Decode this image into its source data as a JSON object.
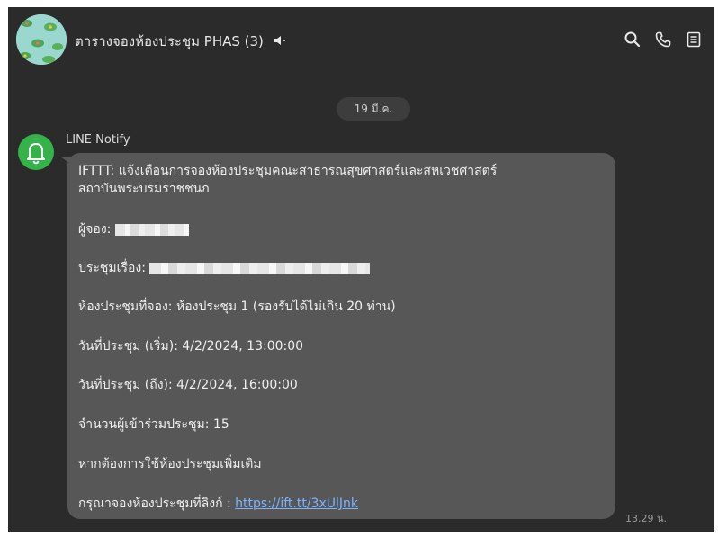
{
  "header": {
    "title": "ตารางจองห้องประชุม PHAS (3)",
    "icons": [
      "speaker-muted-icon",
      "search-icon",
      "phone-icon",
      "notes-icon"
    ]
  },
  "date_separator": "19 มี.ค.",
  "message": {
    "sender": "LINE Notify",
    "lines": [
      "IFTTT: แจ้งเตือนการจองห้องประชุมคณะสาธารณสุขศาสตร์และสหเวชศาสตร์",
      "สถาบันพระบรมราชชนก",
      "ผู้จอง:",
      "ประชุมเรื่อง:",
      "ห้องประชุมที่จอง: ห้องประชุม 1 (รองรับได้ไม่เกิน 20 ท่าน)",
      "วันที่ประชุม (เริ่ม): 4/2/2024, 13:00:00",
      "วันที่ประชุม (ถึง): 4/2/2024, 16:00:00",
      "จำนวนผู้เข้าร่วมประชุม: 15",
      "หากต้องการใช้ห้องประชุมเพิ่มเติม",
      "กรุณาจองห้องประชุมที่ลิงก์ :"
    ],
    "link": "https://ift.tt/3xUlJnk",
    "time": "13.29 น."
  },
  "colors": {
    "background": "#2b2b2b",
    "bubble": "#575757",
    "bot_avatar": "#35b24a",
    "link": "#7ab4ff"
  }
}
